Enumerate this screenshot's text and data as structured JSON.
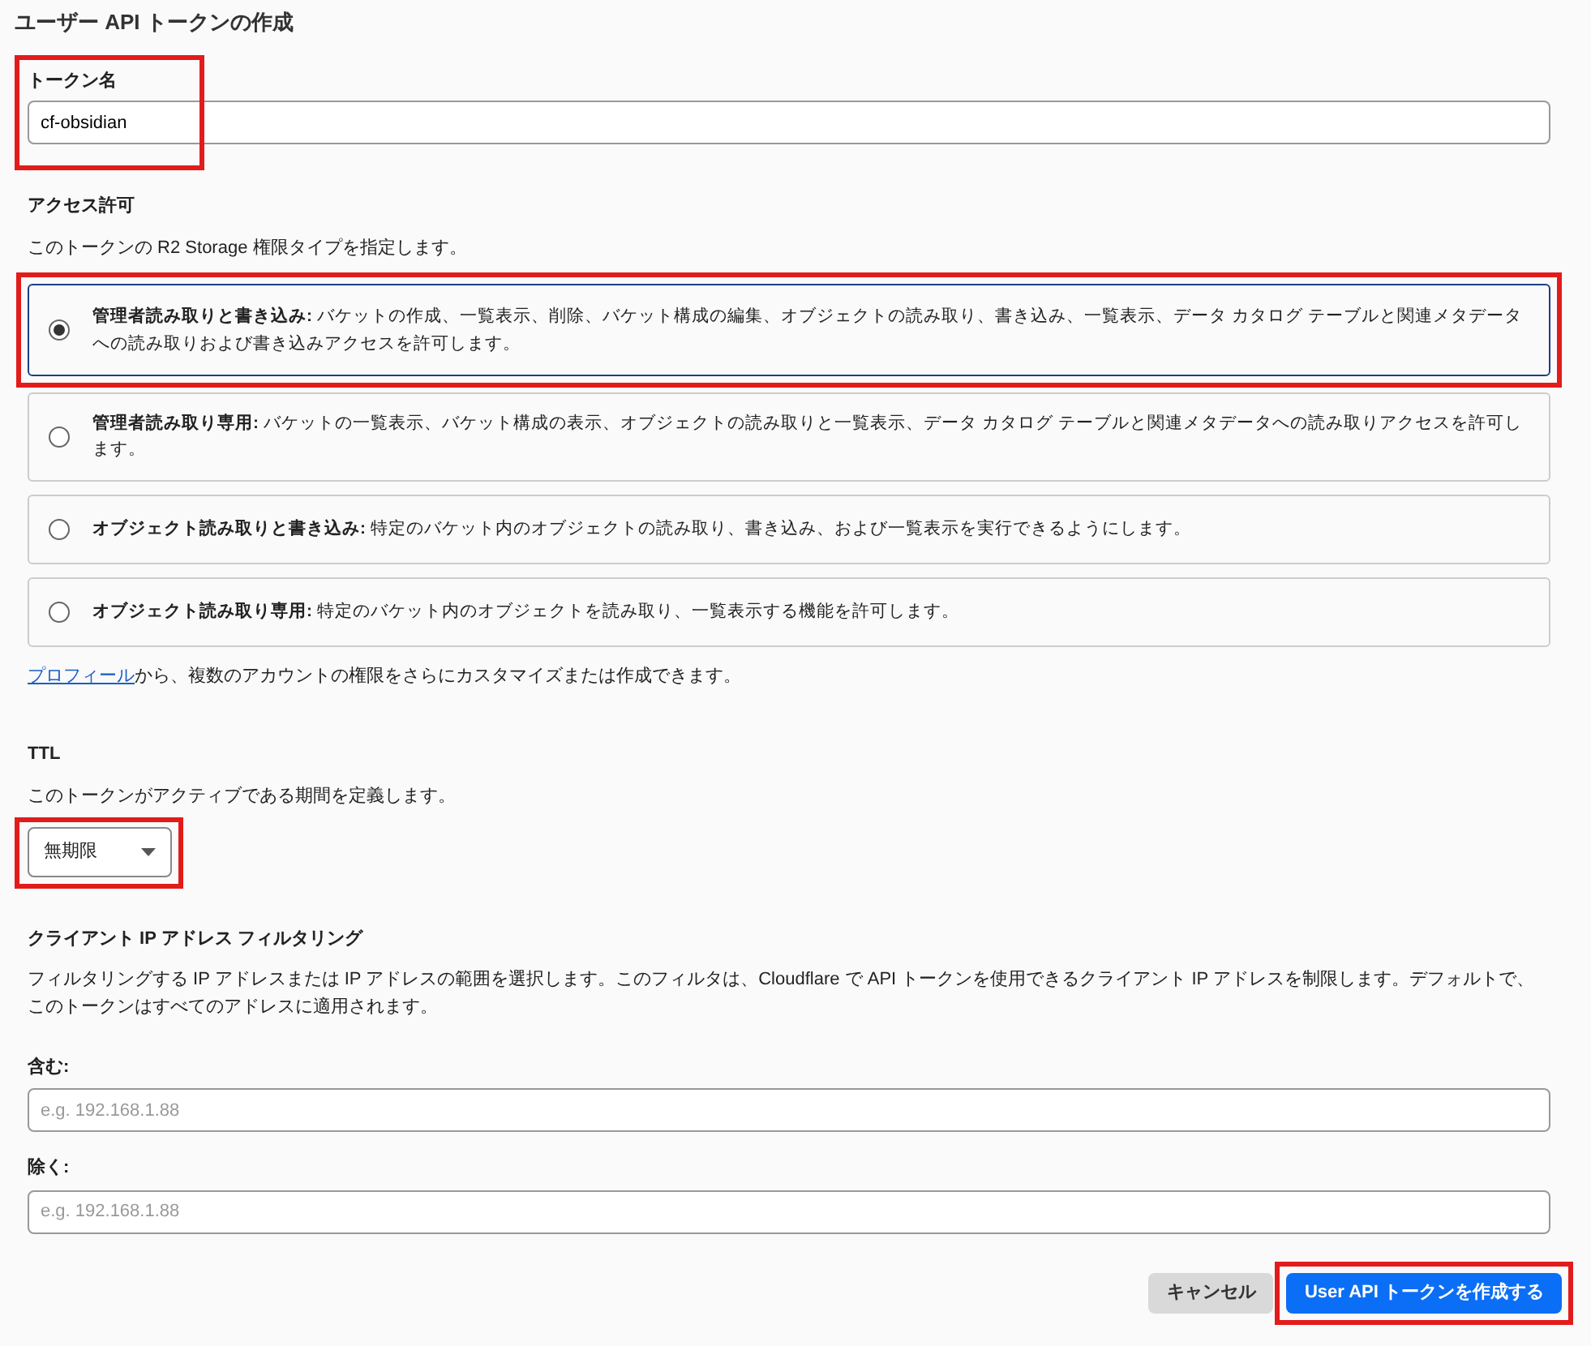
{
  "page_title": "ユーザー API トークンの作成",
  "token_name": {
    "label": "トークン名",
    "value": "cf-obsidian",
    "highlighted": true
  },
  "permissions": {
    "label": "アクセス許可",
    "description": "このトークンの R2 Storage 権限タイプを指定します。",
    "options": [
      {
        "text": "**管理者読み取りと書き込み:** バケットの作成、一覧表示、削除、バケット構成の編集、オブジェクトの読み取り、書き込み、一覧表示、データ カタログ テーブルと関連メタデータへの読み取りおよび書き込みアクセスを許可します。",
        "selected": true,
        "highlighted": true
      },
      {
        "text": "**管理者読み取り専用:** バケットの一覧表示、バケット構成の表示、オブジェクトの読み取りと一覧表示、データ カタログ テーブルと関連メタデータへの読み取りアクセスを許可します。",
        "selected": false,
        "highlighted": false
      },
      {
        "text": "**オブジェクト読み取りと書き込み:** 特定のバケット内のオブジェクトの読み取り、書き込み、および一覧表示を実行できるようにします。",
        "selected": false,
        "highlighted": false
      },
      {
        "text": "**オブジェクト読み取り専用:** 特定のバケット内のオブジェクトを読み取り、一覧表示する機能を許可します。",
        "selected": false,
        "highlighted": false
      }
    ],
    "note": {
      "link": "プロフィール",
      "text": "から、複数のアカウントの権限をさらにカスタマイズまたは作成できます。"
    }
  },
  "ttl": {
    "label": "TTL",
    "description": "このトークンがアクティブである期間を定義します。",
    "value": "無期限",
    "highlighted": true
  },
  "ip_filtering": {
    "label": "クライアント IP アドレス フィルタリング",
    "description": "フィルタリングする IP アドレスまたは IP アドレスの範囲を選択します。このフィルタは、Cloudflare で API トークンを使用できるクライアント IP アドレスを制限します。デフォルトで、このトークンはすべてのアドレスに適用されます。",
    "fields": [
      {
        "label": "含む:",
        "placeholder": "e.g. 192.168.1.88"
      },
      {
        "label": "除く:",
        "placeholder": "e.g. 192.168.1.88"
      }
    ]
  },
  "buttons": [
    {
      "label": "キャンセル",
      "kind": "secondary",
      "highlighted": false
    },
    {
      "label": "User API トークンを作成する",
      "kind": "primary",
      "highlighted": true
    }
  ]
}
